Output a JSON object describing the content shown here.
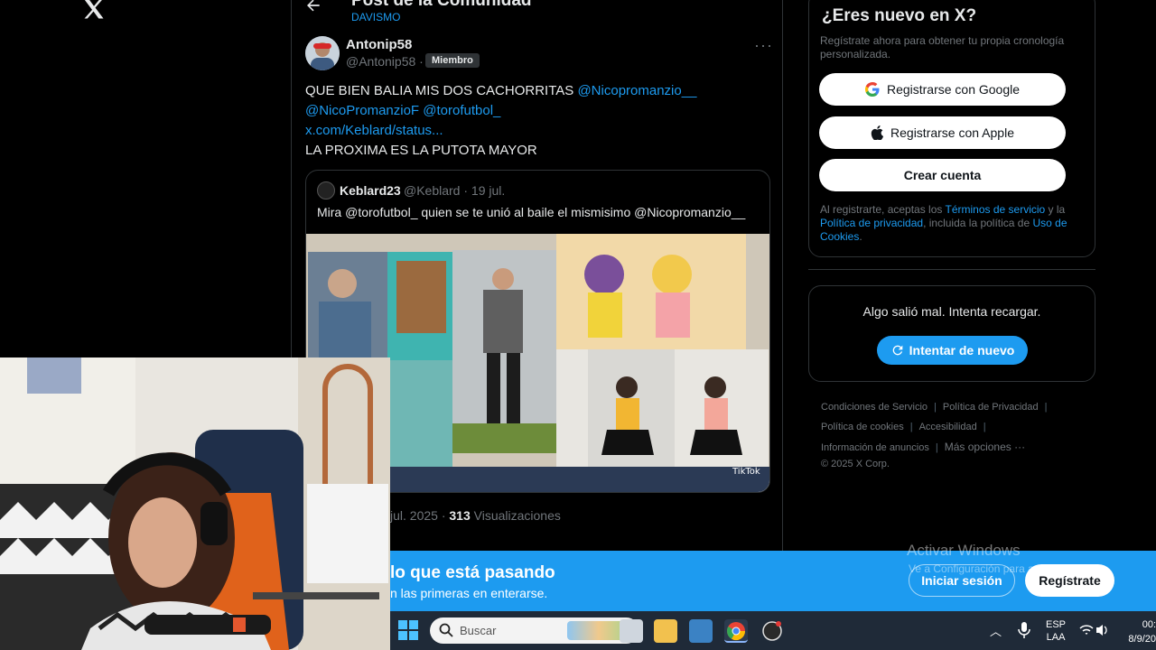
{
  "nav": {
    "logo_icon": "x-logo-icon"
  },
  "header": {
    "title": "Post de la Comunidad",
    "community": "DAVISMO",
    "back_icon": "arrow-left-icon"
  },
  "post": {
    "author_name": "Antonip58",
    "author_handle": "@Antonip58 ·",
    "member_badge": "Miembro",
    "text_line1": "QUE BIEN BALIA MIS DOS CACHORRITAS ",
    "mention1": "@Nicopromanzio__",
    "mention2": "@NicoPromanzioF",
    "mention3": "@torofutbol_",
    "link": "x.com/Keblard/status...",
    "text_line4": "LA PROXIMA ES LA PUTOTA MAYOR",
    "views_date": "jul. 2025 · ",
    "views_count": "313",
    "views_label": " Visualizaciones"
  },
  "quote": {
    "name": "Keblard23",
    "handle": "@Keblard · 19 jul.",
    "text": "Mira @torofutbol_ quien se te unió al baile el mismisimo @Nicopromanzio__",
    "watermark": "TikTok"
  },
  "sidebar": {
    "new_title": "¿Eres nuevo en X?",
    "new_desc": "Regístrate ahora para obtener tu propia cronología personalizada.",
    "google_label": "Registrarse con Google",
    "apple_label": "Registrarse con Apple",
    "create_label": "Crear cuenta",
    "legal_pre": "Al registrarte, aceptas los ",
    "legal_terms": "Términos de servicio",
    "legal_mid1": " y la ",
    "legal_privacy": "Política de privacidad",
    "legal_mid2": ", incluida la política de ",
    "legal_cookies": "Uso de Cookies",
    "legal_end": ".",
    "error_text": "Algo salió mal. Intenta recargar.",
    "retry_label": "Intentar de nuevo"
  },
  "footer": {
    "terms": "Condiciones de Servicio",
    "privacy": "Política de Privacidad",
    "cookies": "Política de cookies",
    "accessibility": "Accesibilidad",
    "ads_info": "Información de anuncios",
    "more": "Más opciones ···",
    "copyright": "© 2025 X Corp."
  },
  "signup_bar": {
    "title": "lo que está pasando",
    "subtitle": "n las primeras en enterarse.",
    "login_label": "Iniciar sesión",
    "signup_label": "Regístrate"
  },
  "windows": {
    "activate_title": "Activar Windows",
    "activate_sub": "Ve a Configuración para activar Windows."
  },
  "taskbar": {
    "search_placeholder": "Buscar",
    "lang_line1": "ESP",
    "lang_line2": "LAA",
    "time": "00:",
    "date": "8/9/20"
  },
  "colors": {
    "accent": "#1d9bf0",
    "background": "#000000",
    "border": "#2f3336",
    "muted_text": "#71767b"
  }
}
